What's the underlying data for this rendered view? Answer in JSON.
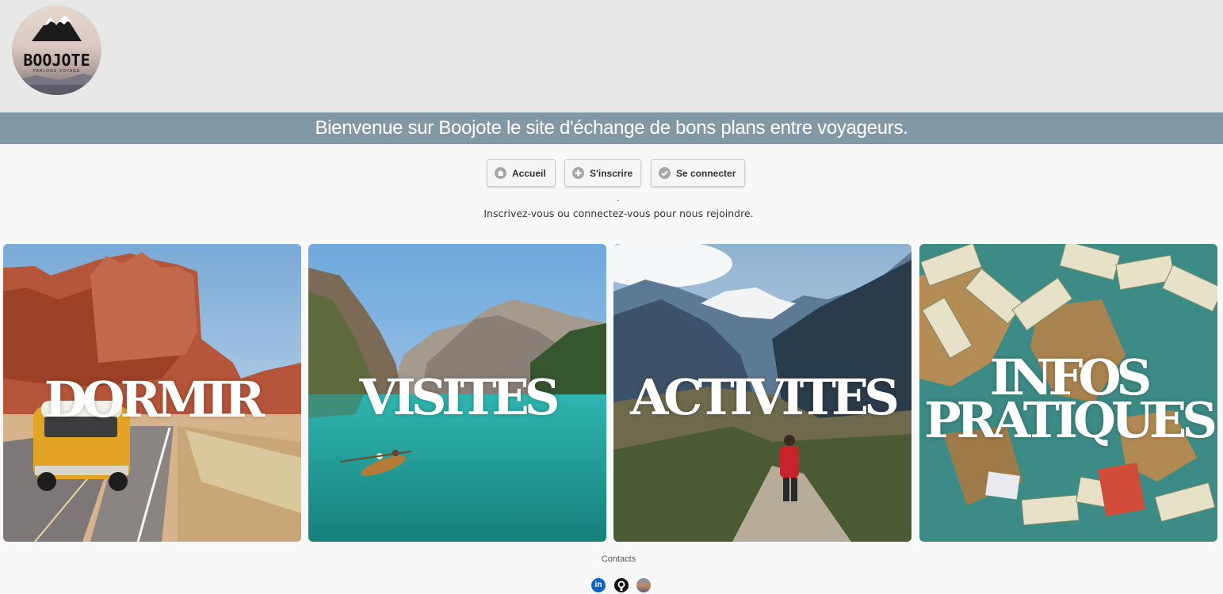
{
  "logo": {
    "title": "BOOJOTE",
    "subtitle": "PARLONS VOYAGE"
  },
  "banner": {
    "text": "Bienvenue sur Boojote le site d'échange de bons plans entre voyageurs."
  },
  "nav": {
    "items": [
      {
        "label": "Accueil",
        "icon": "home-icon"
      },
      {
        "label": "S'inscrire",
        "icon": "plus-icon"
      },
      {
        "label": "Se connecter",
        "icon": "check-icon"
      }
    ]
  },
  "main": {
    "dot": ".",
    "invite_text": "Inscrivez-vous ou connectez-vous pour nous rejoindre."
  },
  "cards": [
    {
      "title": "DORMIR"
    },
    {
      "title": "VISITES"
    },
    {
      "title": "ACTIVITES"
    },
    {
      "title_line1": "INFOS",
      "title_line2": "PRATIQUES"
    }
  ],
  "footer": {
    "contacts_label": "Contacts",
    "social": [
      {
        "icon": "linkedin-icon",
        "text": "in"
      },
      {
        "icon": "github-icon"
      },
      {
        "icon": "avatar-icon"
      }
    ]
  }
}
